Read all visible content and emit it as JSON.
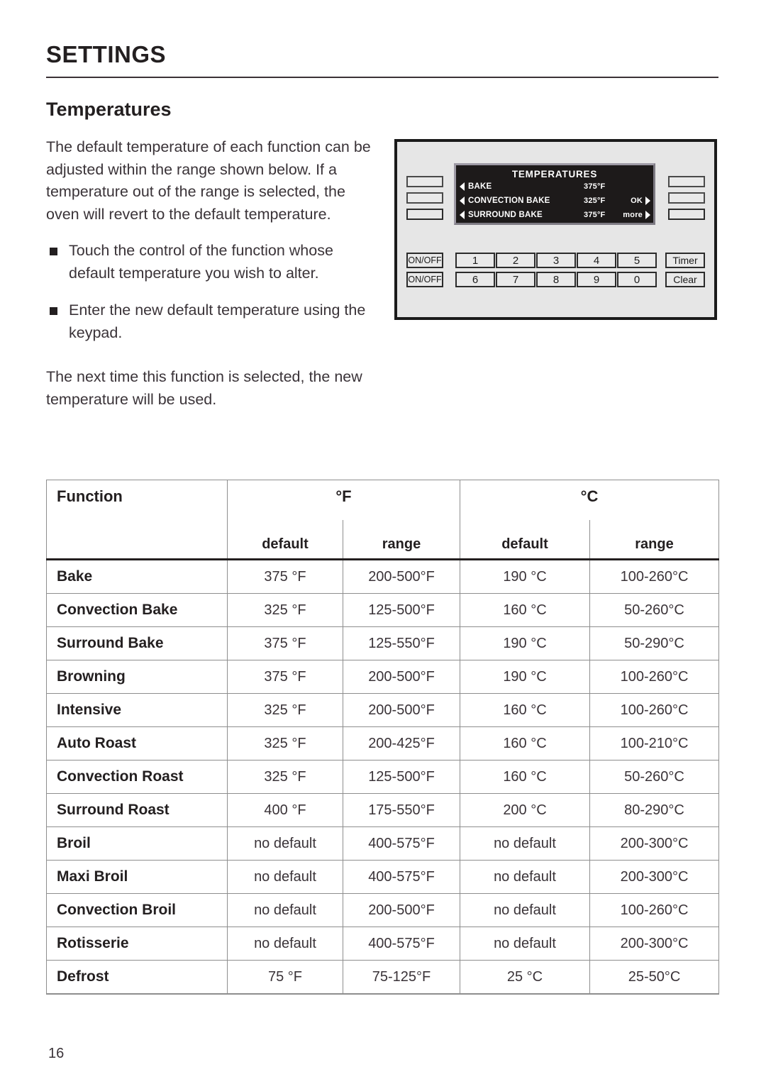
{
  "page": {
    "title": "SETTINGS",
    "section": "Temperatures",
    "number": "16"
  },
  "body": {
    "intro": "The default temperature of each function can be adjusted within the range shown below. If a temperature out of the range is selected, the oven will revert to the default temperature.",
    "bullets": [
      "Touch the control of the function whose default temperature you wish to alter.",
      "Enter the new default temperature using the keypad."
    ],
    "closing": "The next time this function is selected, the new temperature will be used."
  },
  "panel": {
    "display": {
      "title": "TEMPERATURES",
      "rows": [
        {
          "label": "BAKE",
          "temp": "375°F",
          "action": ""
        },
        {
          "label": "CONVECTION BAKE",
          "temp": "325°F",
          "action": "OK"
        },
        {
          "label": "SURROUND BAKE",
          "temp": "375°F",
          "action": "more"
        }
      ]
    },
    "left_power_keys": [
      "ON/OFF",
      "ON/OFF"
    ],
    "numeric_keys_row1": [
      "1",
      "2",
      "3",
      "4",
      "5"
    ],
    "numeric_keys_row2": [
      "6",
      "7",
      "8",
      "9",
      "0"
    ],
    "right_keys": [
      "Timer",
      "Clear"
    ],
    "colors": {
      "panel_face": "#e6e6e6",
      "panel_border": "#1b1b1b",
      "lcd_background": "#1d1a1a",
      "lcd_text": "#ffffff"
    }
  },
  "table": {
    "col_function": "Function",
    "col_f": "°F",
    "col_c": "°C",
    "sub_default": "default",
    "sub_range": "range",
    "rows": [
      {
        "function": "Bake",
        "f_default": "375 °F",
        "f_range": "200-500°F",
        "c_default": "190 °C",
        "c_range": "100-260°C"
      },
      {
        "function": "Convection Bake",
        "f_default": "325 °F",
        "f_range": "125-500°F",
        "c_default": "160 °C",
        "c_range": "50-260°C"
      },
      {
        "function": "Surround Bake",
        "f_default": "375 °F",
        "f_range": "125-550°F",
        "c_default": "190 °C",
        "c_range": "50-290°C"
      },
      {
        "function": "Browning",
        "f_default": "375 °F",
        "f_range": "200-500°F",
        "c_default": "190 °C",
        "c_range": "100-260°C"
      },
      {
        "function": "Intensive",
        "f_default": "325 °F",
        "f_range": "200-500°F",
        "c_default": "160 °C",
        "c_range": "100-260°C"
      },
      {
        "function": "Auto Roast",
        "f_default": "325 °F",
        "f_range": "200-425°F",
        "c_default": "160 °C",
        "c_range": "100-210°C"
      },
      {
        "function": "Convection Roast",
        "f_default": "325 °F",
        "f_range": "125-500°F",
        "c_default": "160 °C",
        "c_range": "50-260°C"
      },
      {
        "function": "Surround Roast",
        "f_default": "400 °F",
        "f_range": "175-550°F",
        "c_default": "200 °C",
        "c_range": "80-290°C"
      },
      {
        "function": "Broil",
        "f_default": "no default",
        "f_range": "400-575°F",
        "c_default": "no default",
        "c_range": "200-300°C"
      },
      {
        "function": "Maxi Broil",
        "f_default": "no default",
        "f_range": "400-575°F",
        "c_default": "no default",
        "c_range": "200-300°C"
      },
      {
        "function": "Convection Broil",
        "f_default": "no default",
        "f_range": "200-500°F",
        "c_default": "no default",
        "c_range": "100-260°C"
      },
      {
        "function": "Rotisserie",
        "f_default": "no default",
        "f_range": "400-575°F",
        "c_default": "no default",
        "c_range": "200-300°C"
      },
      {
        "function": "Defrost",
        "f_default": "75 °F",
        "f_range": "75-125°F",
        "c_default": "25 °C",
        "c_range": "25-50°C"
      }
    ]
  }
}
